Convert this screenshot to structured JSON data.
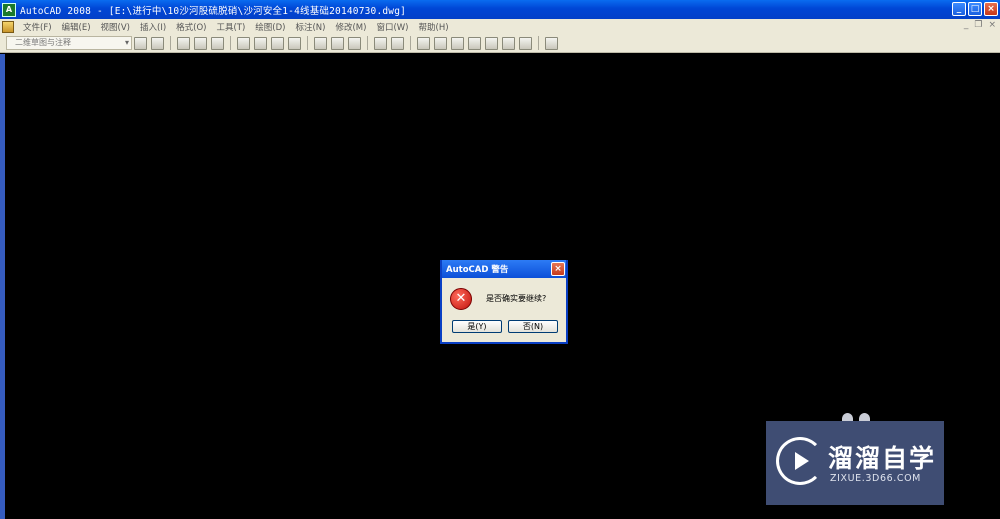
{
  "window": {
    "title": "AutoCAD 2008 - [E:\\进行中\\10沙河股硫脱硝\\沙河安全1-4线基础20140730.dwg]",
    "app_icon": "A",
    "controls": {
      "minimize": "_",
      "maximize": "□",
      "close": "×"
    }
  },
  "menubar": {
    "items": [
      {
        "label": "文件(F)"
      },
      {
        "label": "编辑(E)"
      },
      {
        "label": "视图(V)"
      },
      {
        "label": "插入(I)"
      },
      {
        "label": "格式(O)"
      },
      {
        "label": "工具(T)"
      },
      {
        "label": "绘图(D)"
      },
      {
        "label": "标注(N)"
      },
      {
        "label": "修改(M)"
      },
      {
        "label": "窗口(W)"
      },
      {
        "label": "帮助(H)"
      }
    ],
    "doc_controls": {
      "minimize": "_",
      "restore": "❐",
      "close": "×"
    }
  },
  "toolbar": {
    "workspace_value": "二维草图与注释",
    "dropdown_arrow": "▾",
    "icons": [
      "workspace-settings-icon",
      "workspace-save-icon",
      "new-icon",
      "open-icon",
      "save-icon",
      "plot-icon",
      "plot-preview-icon",
      "publish-icon",
      "cut-icon",
      "copy-icon",
      "paste-icon",
      "match-properties-icon",
      "undo-icon",
      "redo-icon",
      "pan-icon",
      "zoom-icon",
      "properties-icon",
      "design-center-icon",
      "tool-palettes-icon",
      "sheet-set-icon",
      "markup-icon",
      "calculator-icon"
    ]
  },
  "dialog": {
    "title": "AutoCAD 警告",
    "close_label": "×",
    "icon": "error-icon",
    "icon_glyph": "✕",
    "message": "是否确实要继续?",
    "yes_label": "是(Y)",
    "no_label": "否(N)"
  },
  "watermark": {
    "brand": "溜溜自学",
    "url": "ZIXUE.3D66.COM"
  },
  "colors": {
    "titlebar": "#0046d5",
    "canvas": "#000000",
    "chrome": "#ece9d8",
    "watermark_bg": "#3f4d73"
  }
}
